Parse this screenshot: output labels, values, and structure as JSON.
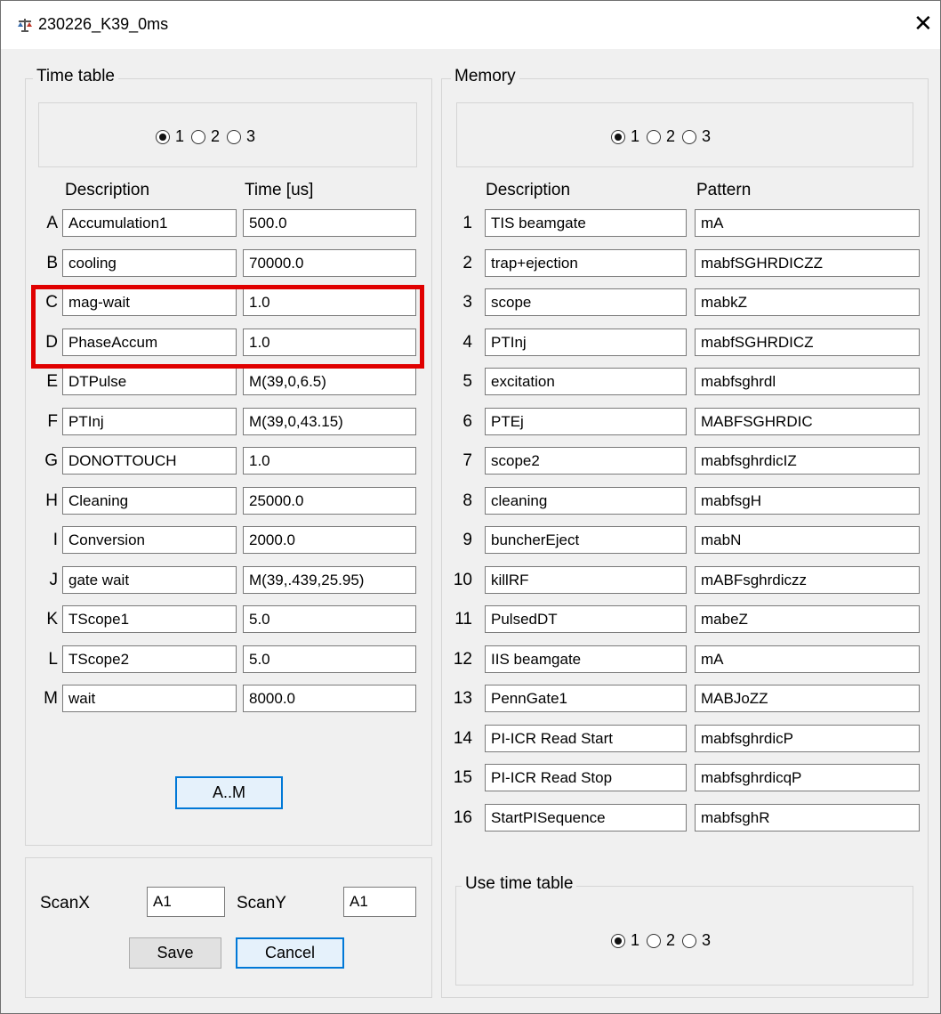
{
  "window": {
    "title": "230226_K39_0ms",
    "close_glyph": "✕"
  },
  "time_table": {
    "legend": "Time table",
    "radio": {
      "options": [
        "1",
        "2",
        "3"
      ],
      "selected": "1"
    },
    "header_desc": "Description",
    "header_time": "Time [us]",
    "rows": [
      {
        "label": "A",
        "desc": "Accumulation1",
        "time": "500.0"
      },
      {
        "label": "B",
        "desc": "cooling",
        "time": "70000.0"
      },
      {
        "label": "C",
        "desc": "mag-wait",
        "time": "1.0"
      },
      {
        "label": "D",
        "desc": "PhaseAccum",
        "time": "1.0"
      },
      {
        "label": "E",
        "desc": "DTPulse",
        "time": "M(39,0,6.5)"
      },
      {
        "label": "F",
        "desc": "PTInj",
        "time": "M(39,0,43.15)"
      },
      {
        "label": "G",
        "desc": "DONOTTOUCH",
        "time": "1.0"
      },
      {
        "label": "H",
        "desc": "Cleaning",
        "time": "25000.0"
      },
      {
        "label": "I",
        "desc": "Conversion",
        "time": "2000.0"
      },
      {
        "label": "J",
        "desc": "gate wait",
        "time": "M(39,.439,25.95)"
      },
      {
        "label": "K",
        "desc": "TScope1",
        "time": "5.0"
      },
      {
        "label": "L",
        "desc": "TScope2",
        "time": "5.0"
      },
      {
        "label": "M",
        "desc": "wait",
        "time": "8000.0"
      }
    ],
    "am_button": "A..M"
  },
  "scan": {
    "scanx_label": "ScanX",
    "scanx_value": "A1",
    "scany_label": "ScanY",
    "scany_value": "A1",
    "save_label": "Save",
    "cancel_label": "Cancel"
  },
  "memory": {
    "legend": "Memory",
    "radio": {
      "options": [
        "1",
        "2",
        "3"
      ],
      "selected": "1"
    },
    "header_desc": "Description",
    "header_pattern": "Pattern",
    "rows": [
      {
        "label": "1",
        "desc": "TIS beamgate",
        "pattern": "mA"
      },
      {
        "label": "2",
        "desc": "trap+ejection",
        "pattern": "mabfSGHRDICZZ"
      },
      {
        "label": "3",
        "desc": "scope",
        "pattern": "mabkZ"
      },
      {
        "label": "4",
        "desc": "PTInj",
        "pattern": "mabfSGHRDICZ"
      },
      {
        "label": "5",
        "desc": "excitation",
        "pattern": "mabfsghrdl"
      },
      {
        "label": "6",
        "desc": "PTEj",
        "pattern": "MABFSGHRDIC"
      },
      {
        "label": "7",
        "desc": "scope2",
        "pattern": "mabfsghrdicIZ"
      },
      {
        "label": "8",
        "desc": "cleaning",
        "pattern": "mabfsgH"
      },
      {
        "label": "9",
        "desc": "buncherEject",
        "pattern": "mabN"
      },
      {
        "label": "10",
        "desc": "killRF",
        "pattern": "mABFsghrdiczz"
      },
      {
        "label": "11",
        "desc": "PulsedDT",
        "pattern": "mabeZ"
      },
      {
        "label": "12",
        "desc": "IIS beamgate",
        "pattern": "mA"
      },
      {
        "label": "13",
        "desc": "PennGate1",
        "pattern": "MABJoZZ"
      },
      {
        "label": "14",
        "desc": "PI-ICR Read Start",
        "pattern": "mabfsghrdicP"
      },
      {
        "label": "15",
        "desc": "PI-ICR Read Stop",
        "pattern": "mabfsghrdicqP"
      },
      {
        "label": "16",
        "desc": "StartPISequence",
        "pattern": "mabfsghR"
      }
    ],
    "use_time_table": {
      "legend": "Use time table",
      "radio": {
        "options": [
          "1",
          "2",
          "3"
        ],
        "selected": "1"
      }
    }
  },
  "colors": {
    "highlight": "#e00000",
    "focus": "#0078d7"
  },
  "icons": {
    "app": "balance-scale-icon"
  }
}
